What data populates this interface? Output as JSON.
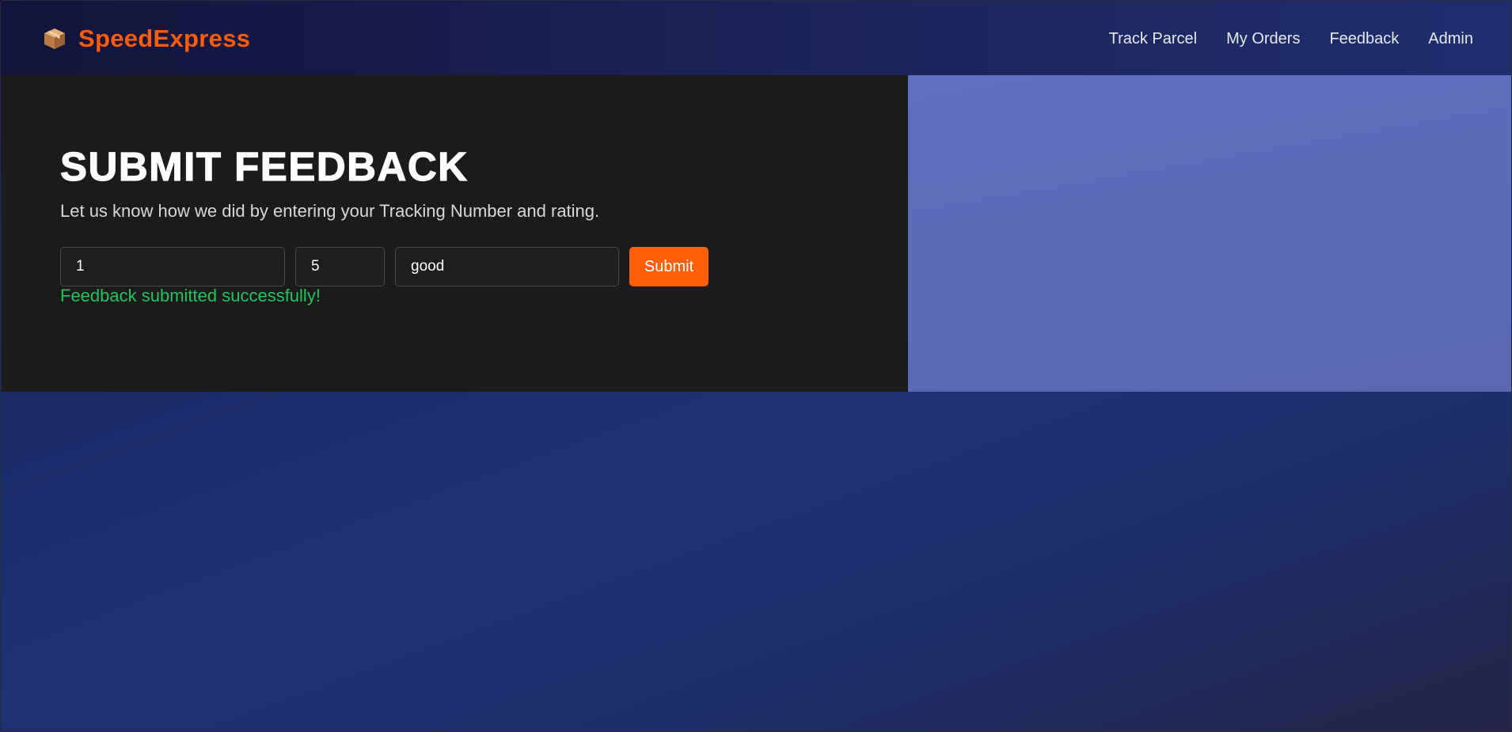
{
  "brand": {
    "name": "SpeedExpress",
    "icon": "package-box-icon"
  },
  "nav": {
    "items": [
      {
        "label": "Track Parcel"
      },
      {
        "label": "My Orders"
      },
      {
        "label": "Feedback"
      },
      {
        "label": "Admin"
      }
    ]
  },
  "feedback": {
    "title": "SUBMIT FEEDBACK",
    "subtitle": "Let us know how we did by entering your Tracking Number and rating.",
    "tracking_number_value": "1",
    "rating_value": "5",
    "comment_value": "good",
    "submit_label": "Submit",
    "status_message": "Feedback submitted successfully!"
  },
  "colors": {
    "accent": "#ff5f07",
    "success": "#22c45e",
    "panel_dark": "#1b1b1b",
    "panel_blue": "#5c70be"
  }
}
